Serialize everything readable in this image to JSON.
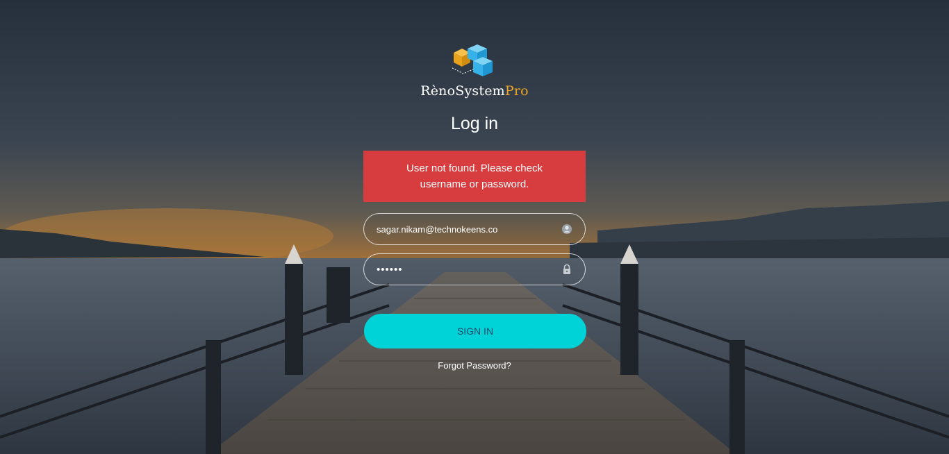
{
  "brand": {
    "name_main": "RènoSystem",
    "name_accent": "Pro",
    "accent_color": "#f0a526",
    "logo_icon": "cubes-logo-icon"
  },
  "login": {
    "title": "Log in",
    "error_message": "User not found. Please check username or password.",
    "error_color": "#d73c3e",
    "username": {
      "value": "sagar.nikam@technokeens.co",
      "icon": "user-icon"
    },
    "password": {
      "value": "••••••",
      "icon": "lock-icon"
    },
    "signin_label": "SIGN IN",
    "signin_color": "#00d3d8",
    "forgot_label": "Forgot Password?"
  }
}
